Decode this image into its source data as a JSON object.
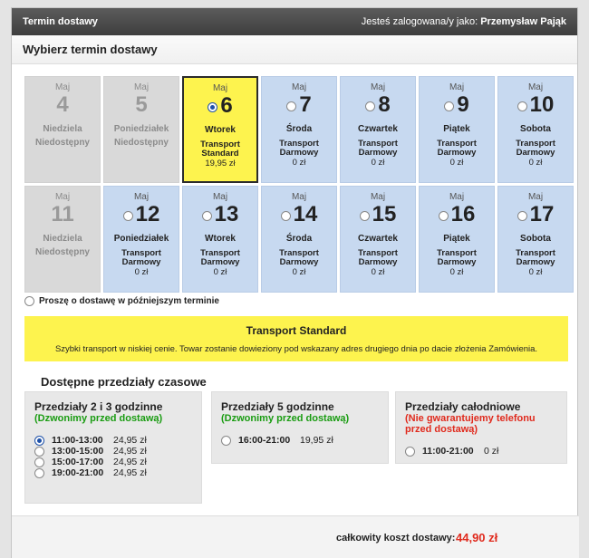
{
  "header": {
    "title": "Termin dostawy",
    "user_prefix": "Jesteś zalogowana/y jako:",
    "user_name": "Przemysław Pająk"
  },
  "subheader": "Wybierz termin dostawy",
  "days": [
    {
      "month": "Maj",
      "num": "4",
      "weekday": "Niedziela",
      "status": "unavailable",
      "unavailable_label": "Niedostępny"
    },
    {
      "month": "Maj",
      "num": "5",
      "weekday": "Poniedziałek",
      "status": "unavailable",
      "unavailable_label": "Niedostępny"
    },
    {
      "month": "Maj",
      "num": "6",
      "weekday": "Wtorek",
      "status": "selected",
      "transport": "Transport Standard",
      "price": "19,95 zł"
    },
    {
      "month": "Maj",
      "num": "7",
      "weekday": "Środa",
      "status": "available",
      "transport": "Transport Darmowy",
      "price": "0 zł"
    },
    {
      "month": "Maj",
      "num": "8",
      "weekday": "Czwartek",
      "status": "available",
      "transport": "Transport Darmowy",
      "price": "0 zł"
    },
    {
      "month": "Maj",
      "num": "9",
      "weekday": "Piątek",
      "status": "available",
      "transport": "Transport Darmowy",
      "price": "0 zł"
    },
    {
      "month": "Maj",
      "num": "10",
      "weekday": "Sobota",
      "status": "available",
      "transport": "Transport Darmowy",
      "price": "0 zł"
    },
    {
      "month": "Maj",
      "num": "11",
      "weekday": "Niedziela",
      "status": "unavailable",
      "unavailable_label": "Niedostępny"
    },
    {
      "month": "Maj",
      "num": "12",
      "weekday": "Poniedziałek",
      "status": "available",
      "transport": "Transport Darmowy",
      "price": "0 zł"
    },
    {
      "month": "Maj",
      "num": "13",
      "weekday": "Wtorek",
      "status": "available",
      "transport": "Transport Darmowy",
      "price": "0 zł"
    },
    {
      "month": "Maj",
      "num": "14",
      "weekday": "Środa",
      "status": "available",
      "transport": "Transport Darmowy",
      "price": "0 zł"
    },
    {
      "month": "Maj",
      "num": "15",
      "weekday": "Czwartek",
      "status": "available",
      "transport": "Transport Darmowy",
      "price": "0 zł"
    },
    {
      "month": "Maj",
      "num": "16",
      "weekday": "Piątek",
      "status": "available",
      "transport": "Transport Darmowy",
      "price": "0 zł"
    },
    {
      "month": "Maj",
      "num": "17",
      "weekday": "Sobota",
      "status": "available",
      "transport": "Transport Darmowy",
      "price": "0 zł"
    }
  ],
  "later_option": "Proszę o dostawę w późniejszym terminie",
  "banner": {
    "title": "Transport Standard",
    "description": "Szybki transport w niskiej cenie. Towar zostanie dowieziony pod wskazany adres drugiego dnia po dacie złożenia Zamówienia."
  },
  "slots_title": "Dostępne przedziały czasowe",
  "slot_groups": [
    {
      "title": "Przedziały 2 i 3 godzinne",
      "note": "(Dzwonimy przed dostawą)",
      "note_color": "green",
      "rows": [
        {
          "time": "11:00-13:00",
          "price": "24,95 zł",
          "checked": true
        },
        {
          "time": "13:00-15:00",
          "price": "24,95 zł",
          "checked": false
        },
        {
          "time": "15:00-17:00",
          "price": "24,95 zł",
          "checked": false
        },
        {
          "time": "19:00-21:00",
          "price": "24,95 zł",
          "checked": false
        }
      ]
    },
    {
      "title": "Przedziały 5 godzinne",
      "note": "(Dzwonimy przed dostawą)",
      "note_color": "green",
      "rows": [
        {
          "time": "16:00-21:00",
          "price": "19,95 zł",
          "checked": false
        }
      ]
    },
    {
      "title": "Przedziały całodniowe",
      "note": "(Nie gwarantujemy telefonu przed dostawą)",
      "note_color": "red",
      "rows": [
        {
          "time": "11:00-21:00",
          "price": "0 zł",
          "checked": false
        }
      ]
    }
  ],
  "footer": {
    "label": "całkowity koszt dostawy:",
    "value": "44,90 zł"
  },
  "colors": {
    "available": "#c7d9f0",
    "unavailable": "#d9d9d9",
    "selected": "#fdf34e",
    "accent_red": "#e02a1d",
    "accent_green": "#1a9c12"
  }
}
